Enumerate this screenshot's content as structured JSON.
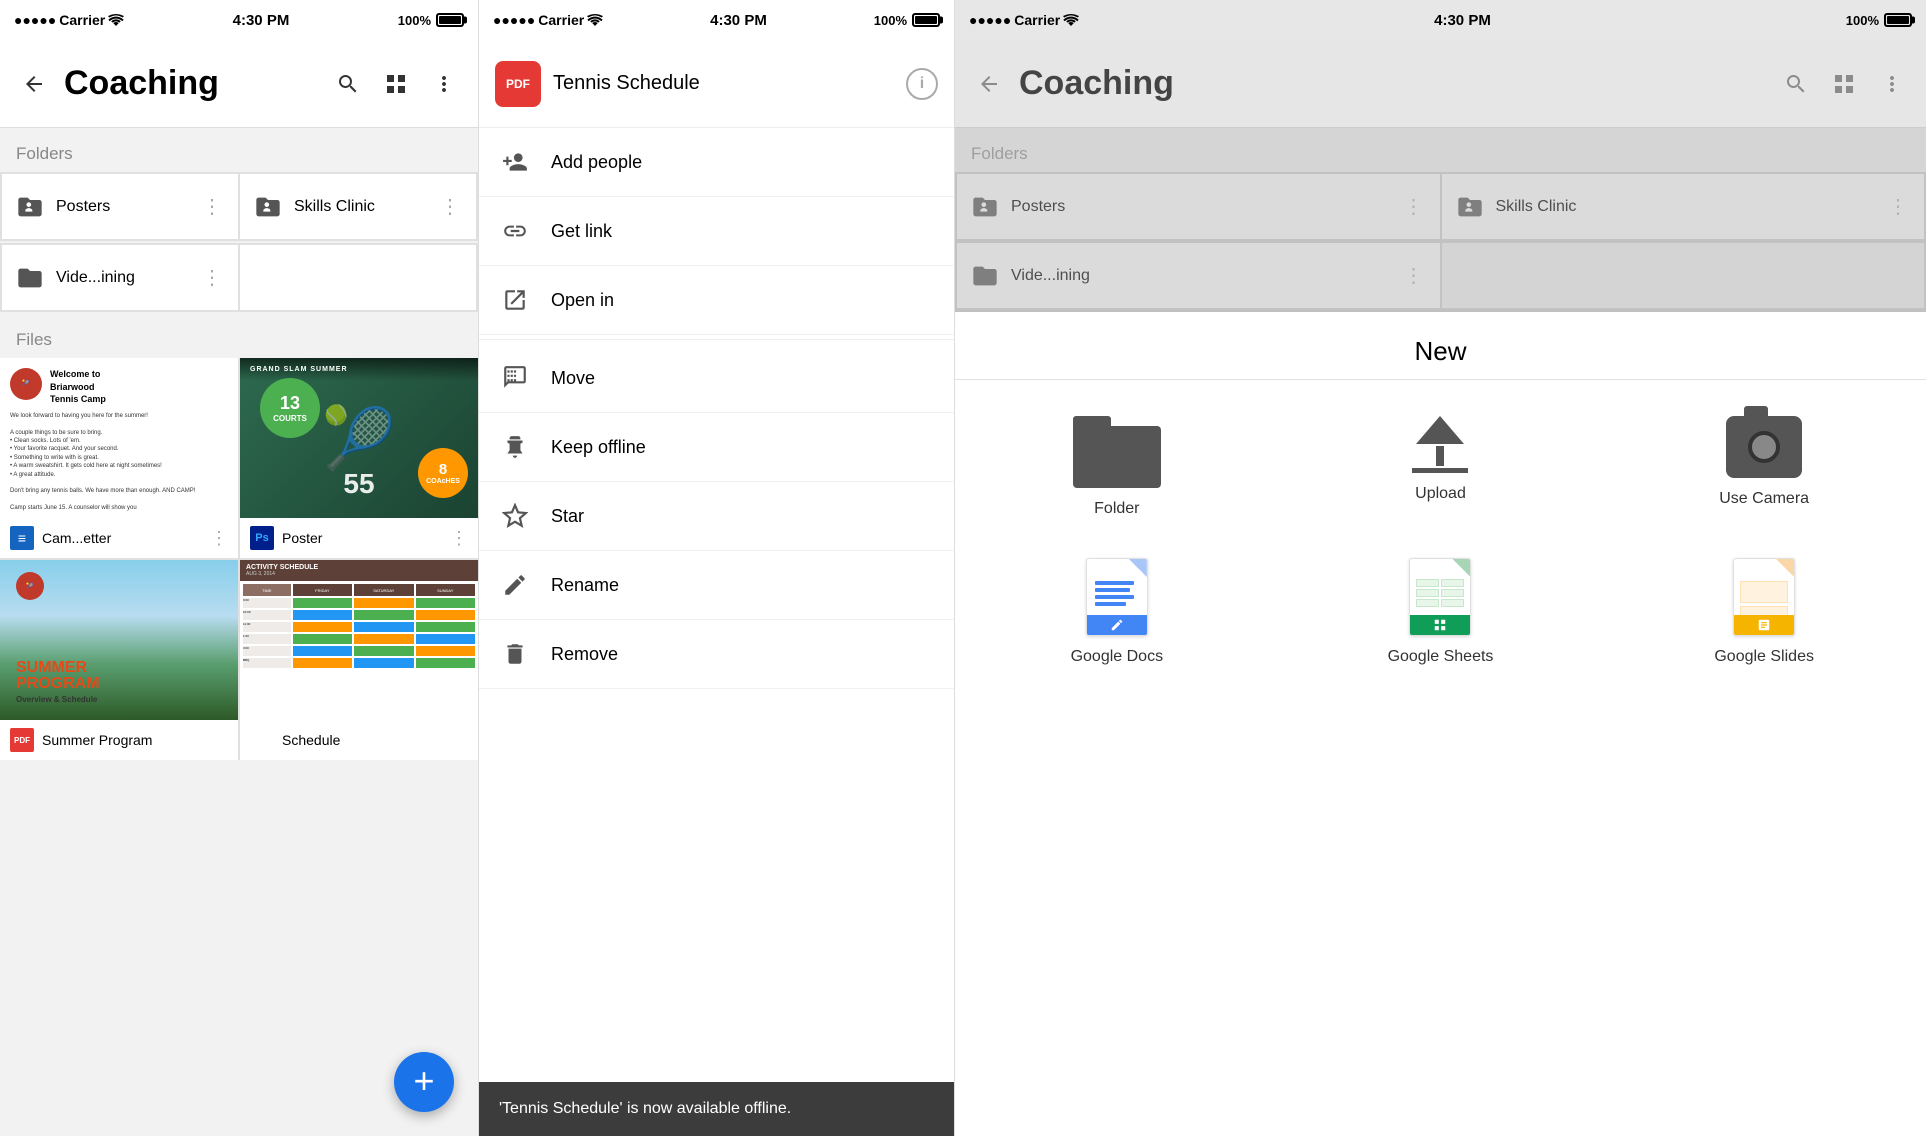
{
  "statusBar": {
    "carrier": "Carrier",
    "wifi": "wifi",
    "time": "4:30 PM",
    "battery": "100%"
  },
  "panel1": {
    "title": "Coaching",
    "backLabel": "Back",
    "foldersLabel": "Folders",
    "filesLabel": "Files",
    "folders": [
      {
        "id": "posters",
        "name": "Posters",
        "type": "shared"
      },
      {
        "id": "skills-clinic",
        "name": "Skills Clinic",
        "type": "shared"
      },
      {
        "id": "video-training",
        "name": "Vide...ining",
        "type": "personal"
      }
    ],
    "files": [
      {
        "id": "camp-letter",
        "name": "Cam...etter",
        "type": "doc"
      },
      {
        "id": "poster",
        "name": "Poster",
        "type": "ps"
      },
      {
        "id": "summer-program",
        "name": "Summer Program",
        "type": "img"
      },
      {
        "id": "schedule",
        "name": "Schedule",
        "type": "img"
      }
    ],
    "fab": "+"
  },
  "panel2": {
    "fileTitle": "Tennis Schedule",
    "pdfLabel": "PDF",
    "menuItems": [
      {
        "id": "add-people",
        "label": "Add people",
        "icon": "person-add"
      },
      {
        "id": "get-link",
        "label": "Get link",
        "icon": "link"
      },
      {
        "id": "open-in",
        "label": "Open in",
        "icon": "open-external"
      },
      {
        "id": "move",
        "label": "Move",
        "icon": "move"
      },
      {
        "id": "keep-offline",
        "label": "Keep offline",
        "icon": "pin"
      },
      {
        "id": "star",
        "label": "Star",
        "icon": "star"
      },
      {
        "id": "rename",
        "label": "Rename",
        "icon": "edit"
      },
      {
        "id": "remove",
        "label": "Remove",
        "icon": "trash"
      }
    ],
    "toast": "'Tennis Schedule' is now available offline."
  },
  "panel3": {
    "title": "Coaching",
    "foldersLabel": "Folders",
    "folders": [
      {
        "id": "posters",
        "name": "Posters",
        "type": "shared"
      },
      {
        "id": "skills-clinic",
        "name": "Skills Clinic",
        "type": "shared"
      },
      {
        "id": "video-training",
        "name": "Vide...ining",
        "type": "personal"
      }
    ],
    "newLabel": "New",
    "newItems": [
      {
        "id": "folder",
        "label": "Folder",
        "icon": "folder"
      },
      {
        "id": "upload",
        "label": "Upload",
        "icon": "upload"
      },
      {
        "id": "camera",
        "label": "Use Camera",
        "icon": "camera"
      },
      {
        "id": "google-docs",
        "label": "Google Docs",
        "icon": "gdoc"
      },
      {
        "id": "google-sheets",
        "label": "Google Sheets",
        "icon": "gsheets"
      },
      {
        "id": "google-slides",
        "label": "Google Slides",
        "icon": "gslides"
      }
    ]
  }
}
